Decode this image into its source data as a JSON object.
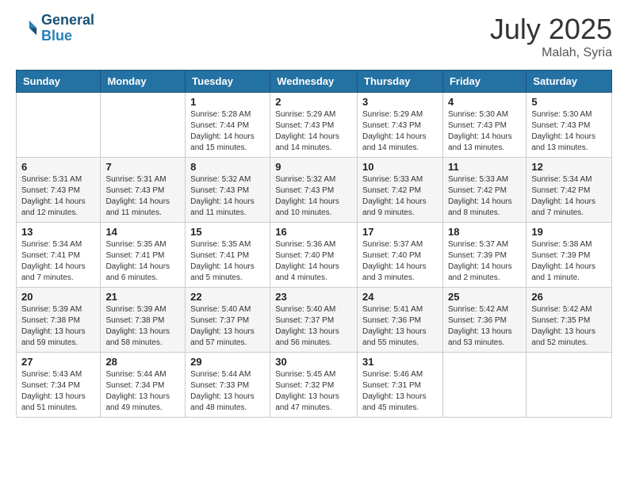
{
  "header": {
    "logo_line1": "General",
    "logo_line2": "Blue",
    "month_title": "July 2025",
    "subtitle": "Malah, Syria"
  },
  "weekdays": [
    "Sunday",
    "Monday",
    "Tuesday",
    "Wednesday",
    "Thursday",
    "Friday",
    "Saturday"
  ],
  "rows": [
    [
      {
        "day": "",
        "info": ""
      },
      {
        "day": "",
        "info": ""
      },
      {
        "day": "1",
        "info": "Sunrise: 5:28 AM\nSunset: 7:44 PM\nDaylight: 14 hours\nand 15 minutes."
      },
      {
        "day": "2",
        "info": "Sunrise: 5:29 AM\nSunset: 7:43 PM\nDaylight: 14 hours\nand 14 minutes."
      },
      {
        "day": "3",
        "info": "Sunrise: 5:29 AM\nSunset: 7:43 PM\nDaylight: 14 hours\nand 14 minutes."
      },
      {
        "day": "4",
        "info": "Sunrise: 5:30 AM\nSunset: 7:43 PM\nDaylight: 14 hours\nand 13 minutes."
      },
      {
        "day": "5",
        "info": "Sunrise: 5:30 AM\nSunset: 7:43 PM\nDaylight: 14 hours\nand 13 minutes."
      }
    ],
    [
      {
        "day": "6",
        "info": "Sunrise: 5:31 AM\nSunset: 7:43 PM\nDaylight: 14 hours\nand 12 minutes."
      },
      {
        "day": "7",
        "info": "Sunrise: 5:31 AM\nSunset: 7:43 PM\nDaylight: 14 hours\nand 11 minutes."
      },
      {
        "day": "8",
        "info": "Sunrise: 5:32 AM\nSunset: 7:43 PM\nDaylight: 14 hours\nand 11 minutes."
      },
      {
        "day": "9",
        "info": "Sunrise: 5:32 AM\nSunset: 7:43 PM\nDaylight: 14 hours\nand 10 minutes."
      },
      {
        "day": "10",
        "info": "Sunrise: 5:33 AM\nSunset: 7:42 PM\nDaylight: 14 hours\nand 9 minutes."
      },
      {
        "day": "11",
        "info": "Sunrise: 5:33 AM\nSunset: 7:42 PM\nDaylight: 14 hours\nand 8 minutes."
      },
      {
        "day": "12",
        "info": "Sunrise: 5:34 AM\nSunset: 7:42 PM\nDaylight: 14 hours\nand 7 minutes."
      }
    ],
    [
      {
        "day": "13",
        "info": "Sunrise: 5:34 AM\nSunset: 7:41 PM\nDaylight: 14 hours\nand 7 minutes."
      },
      {
        "day": "14",
        "info": "Sunrise: 5:35 AM\nSunset: 7:41 PM\nDaylight: 14 hours\nand 6 minutes."
      },
      {
        "day": "15",
        "info": "Sunrise: 5:35 AM\nSunset: 7:41 PM\nDaylight: 14 hours\nand 5 minutes."
      },
      {
        "day": "16",
        "info": "Sunrise: 5:36 AM\nSunset: 7:40 PM\nDaylight: 14 hours\nand 4 minutes."
      },
      {
        "day": "17",
        "info": "Sunrise: 5:37 AM\nSunset: 7:40 PM\nDaylight: 14 hours\nand 3 minutes."
      },
      {
        "day": "18",
        "info": "Sunrise: 5:37 AM\nSunset: 7:39 PM\nDaylight: 14 hours\nand 2 minutes."
      },
      {
        "day": "19",
        "info": "Sunrise: 5:38 AM\nSunset: 7:39 PM\nDaylight: 14 hours\nand 1 minute."
      }
    ],
    [
      {
        "day": "20",
        "info": "Sunrise: 5:39 AM\nSunset: 7:38 PM\nDaylight: 13 hours\nand 59 minutes."
      },
      {
        "day": "21",
        "info": "Sunrise: 5:39 AM\nSunset: 7:38 PM\nDaylight: 13 hours\nand 58 minutes."
      },
      {
        "day": "22",
        "info": "Sunrise: 5:40 AM\nSunset: 7:37 PM\nDaylight: 13 hours\nand 57 minutes."
      },
      {
        "day": "23",
        "info": "Sunrise: 5:40 AM\nSunset: 7:37 PM\nDaylight: 13 hours\nand 56 minutes."
      },
      {
        "day": "24",
        "info": "Sunrise: 5:41 AM\nSunset: 7:36 PM\nDaylight: 13 hours\nand 55 minutes."
      },
      {
        "day": "25",
        "info": "Sunrise: 5:42 AM\nSunset: 7:36 PM\nDaylight: 13 hours\nand 53 minutes."
      },
      {
        "day": "26",
        "info": "Sunrise: 5:42 AM\nSunset: 7:35 PM\nDaylight: 13 hours\nand 52 minutes."
      }
    ],
    [
      {
        "day": "27",
        "info": "Sunrise: 5:43 AM\nSunset: 7:34 PM\nDaylight: 13 hours\nand 51 minutes."
      },
      {
        "day": "28",
        "info": "Sunrise: 5:44 AM\nSunset: 7:34 PM\nDaylight: 13 hours\nand 49 minutes."
      },
      {
        "day": "29",
        "info": "Sunrise: 5:44 AM\nSunset: 7:33 PM\nDaylight: 13 hours\nand 48 minutes."
      },
      {
        "day": "30",
        "info": "Sunrise: 5:45 AM\nSunset: 7:32 PM\nDaylight: 13 hours\nand 47 minutes."
      },
      {
        "day": "31",
        "info": "Sunrise: 5:46 AM\nSunset: 7:31 PM\nDaylight: 13 hours\nand 45 minutes."
      },
      {
        "day": "",
        "info": ""
      },
      {
        "day": "",
        "info": ""
      }
    ]
  ]
}
